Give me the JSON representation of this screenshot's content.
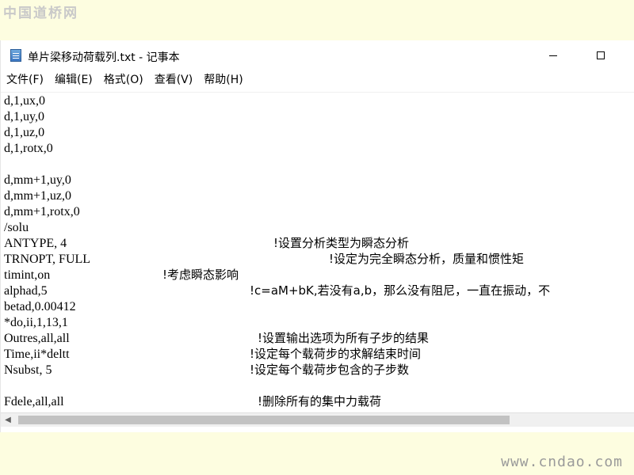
{
  "watermarks": {
    "top": "中国道桥网",
    "bottom": "www.cndao.com"
  },
  "window": {
    "title": "单片梁移动荷载列.txt - 记事本",
    "icon": "notepad-icon",
    "buttons": {
      "minimize": "minimize-icon",
      "maximize": "maximize-icon"
    }
  },
  "menu": [
    {
      "label": "文件(F)"
    },
    {
      "label": "编辑(E)"
    },
    {
      "label": "格式(O)"
    },
    {
      "label": "查看(V)"
    },
    {
      "label": "帮助(H)"
    }
  ],
  "editor": {
    "lines": [
      {
        "code": "d,1,ux,0",
        "comment": ""
      },
      {
        "code": "d,1,uy,0",
        "comment": ""
      },
      {
        "code": "d,1,uz,0",
        "comment": ""
      },
      {
        "code": "d,1,rotx,0",
        "comment": ""
      },
      {
        "code": "",
        "comment": ""
      },
      {
        "code": "d,mm+1,uy,0",
        "comment": ""
      },
      {
        "code": "d,mm+1,uz,0",
        "comment": ""
      },
      {
        "code": "d,mm+1,rotx,0",
        "comment": ""
      },
      {
        "code": "/solu",
        "comment": ""
      },
      {
        "code": "ANTYPE, 4",
        "comment": "!设置分析类型为瞬态分析"
      },
      {
        "code": "TRNOPT, FULL",
        "comment": "!设定为完全瞬态分析，质量和惯性矩"
      },
      {
        "code": "timint,on",
        "comment": "!考虑瞬态影响"
      },
      {
        "code": "alphad,5",
        "comment": "!c=aM+bK,若没有a,b，那么没有阻尼，一直在振动，不"
      },
      {
        "code": "betad,0.00412",
        "comment": ""
      },
      {
        "code": "*do,ii,1,13,1",
        "comment": ""
      },
      {
        "code": "Outres,all,all",
        "comment": "!设置输出选项为所有子步的结果"
      },
      {
        "code": "Time,ii*deltt",
        "comment": "!设定每个载荷步的求解结束时间"
      },
      {
        "code": "Nsubst, 5",
        "comment": "!设定每个载荷步包含的子步数"
      },
      {
        "code": "",
        "comment": ""
      },
      {
        "code": "Fdele,all,all",
        "comment": "!删除所有的集中力载荷"
      }
    ]
  },
  "scrollbar": {
    "left_arrow": "chevron-left-icon"
  }
}
